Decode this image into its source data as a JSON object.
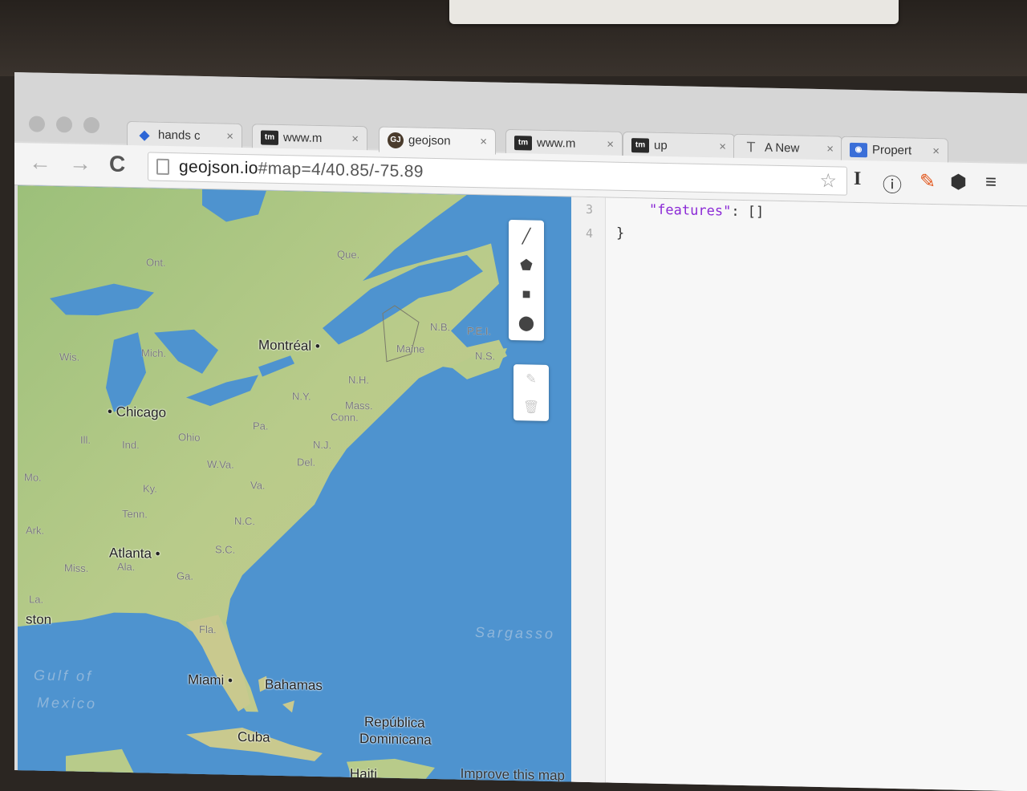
{
  "browser": {
    "tabs": [
      {
        "icon": "hands-icon",
        "fav": "◆",
        "label": "hands c",
        "close": "×"
      },
      {
        "icon": "tm-icon",
        "fav": "tm",
        "label": "www.m",
        "close": "×"
      },
      {
        "icon": "geojson-icon",
        "fav": "GJ",
        "label": "geojson",
        "close": "×",
        "active": true
      },
      {
        "icon": "tm-icon",
        "fav": "tm",
        "label": "www.m",
        "close": "×"
      },
      {
        "icon": "tm-icon",
        "fav": "tm",
        "label": "up",
        "close": "×"
      },
      {
        "icon": "typo-icon",
        "fav": "T",
        "label": "A New",
        "close": "×"
      },
      {
        "icon": "github-icon",
        "fav": "◉",
        "label": "Propert",
        "close": "×"
      }
    ],
    "nav": {
      "back": "←",
      "forward": "→",
      "reload": "C"
    },
    "url": {
      "host": "geojson.io",
      "hash": "#map=4/40.85/-75.89"
    },
    "toolbar_icons": {
      "star": "☆",
      "ext1": "I",
      "ext2": "ⓘ",
      "ext3": "✎",
      "ext4": "⬢",
      "menu": "≡"
    }
  },
  "map": {
    "labels": [
      {
        "text": "Ont.",
        "cls": "small"
      },
      {
        "text": "Que.",
        "cls": "small"
      },
      {
        "text": "Wis.",
        "cls": "small"
      },
      {
        "text": "Mich.",
        "cls": "small"
      },
      {
        "text": "Montréal •",
        "cls": "city"
      },
      {
        "text": "N.B.",
        "cls": "small"
      },
      {
        "text": "P.E.I.",
        "cls": "small"
      },
      {
        "text": "Maine",
        "cls": "small"
      },
      {
        "text": "N.S.",
        "cls": "small"
      },
      {
        "text": "N.H.",
        "cls": "small"
      },
      {
        "text": "N.Y.",
        "cls": "small"
      },
      {
        "text": "Mass.",
        "cls": "small"
      },
      {
        "text": "Conn.",
        "cls": "small"
      },
      {
        "text": "• Chicago",
        "cls": "city"
      },
      {
        "text": "Pa.",
        "cls": "small"
      },
      {
        "text": "Ohio",
        "cls": "small"
      },
      {
        "text": "Ill.",
        "cls": "small"
      },
      {
        "text": "Ind.",
        "cls": "small"
      },
      {
        "text": "N.J.",
        "cls": "small"
      },
      {
        "text": "Del.",
        "cls": "small"
      },
      {
        "text": "W.Va.",
        "cls": "small"
      },
      {
        "text": "Mo.",
        "cls": "small"
      },
      {
        "text": "Va.",
        "cls": "small"
      },
      {
        "text": "Ky.",
        "cls": "small"
      },
      {
        "text": "Tenn.",
        "cls": "small"
      },
      {
        "text": "N.C.",
        "cls": "small"
      },
      {
        "text": "Ark.",
        "cls": "small"
      },
      {
        "text": "Atlanta •",
        "cls": "city"
      },
      {
        "text": "S.C.",
        "cls": "small"
      },
      {
        "text": "Miss.",
        "cls": "small"
      },
      {
        "text": "Ala.",
        "cls": "small"
      },
      {
        "text": "Ga.",
        "cls": "small"
      },
      {
        "text": "La.",
        "cls": "small"
      },
      {
        "text": "ston",
        "cls": "city"
      },
      {
        "text": "Fla.",
        "cls": "small"
      },
      {
        "text": "Sargasso",
        "cls": "sea"
      },
      {
        "text": "Gulf of",
        "cls": "sea"
      },
      {
        "text": "Mexico",
        "cls": "sea"
      },
      {
        "text": "Miami •",
        "cls": "city"
      },
      {
        "text": "Bahamas",
        "cls": "city"
      },
      {
        "text": "República",
        "cls": "city"
      },
      {
        "text": "Dominicana",
        "cls": "city"
      },
      {
        "text": "Cuba",
        "cls": "city"
      },
      {
        "text": "Haiti",
        "cls": "city"
      }
    ],
    "draw_tools": [
      {
        "name": "draw-line-icon",
        "glyph": "╱"
      },
      {
        "name": "draw-polygon-icon",
        "glyph": "⬟"
      },
      {
        "name": "draw-rectangle-icon",
        "glyph": "■"
      },
      {
        "name": "draw-marker-icon",
        "glyph": "⬤"
      }
    ],
    "edit_tools": [
      {
        "name": "edit-layers-icon",
        "glyph": "✎"
      },
      {
        "name": "delete-layers-icon",
        "glyph": "🗑"
      }
    ],
    "improve_link": "Improve this map"
  },
  "editor": {
    "lines": [
      {
        "num": "3",
        "indent": "    ",
        "key": "\"features\"",
        "rest": ": []"
      },
      {
        "num": "4",
        "indent": "",
        "key": "",
        "rest": "}"
      }
    ]
  }
}
